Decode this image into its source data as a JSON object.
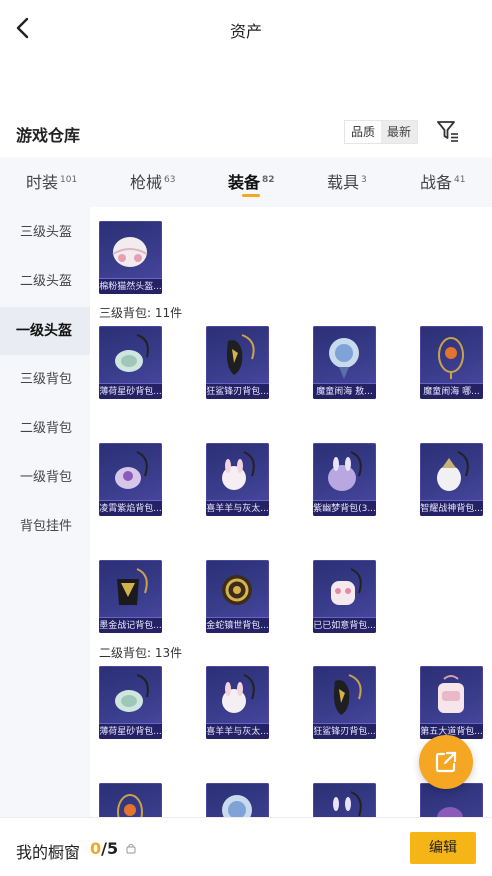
{
  "header": {
    "title": "资产"
  },
  "warehouse": {
    "title": "游戏仓库",
    "sort_options": [
      "品质",
      "最新"
    ],
    "active_sort": "最新"
  },
  "tabs": [
    {
      "label": "时装",
      "count": "101"
    },
    {
      "label": "枪械",
      "count": "63"
    },
    {
      "label": "装备",
      "count": "82",
      "active": true
    },
    {
      "label": "载具",
      "count": "3"
    },
    {
      "label": "战备",
      "count": "41"
    }
  ],
  "sidenav": {
    "items": [
      "三级头盔",
      "二级头盔",
      "一级头盔",
      "三级背包",
      "二级背包",
      "一级背包",
      "背包挂件"
    ],
    "active_index": 2
  },
  "groups": {
    "first": {
      "items": [
        "棉粉猫然头盔..."
      ]
    },
    "level3_bags": {
      "title": "三级背包: 11件",
      "items": [
        "薄荷星砂背包...",
        "狂鲨锋刃背包...",
        "魔童闹海 敖...",
        "魔童闹海 哪...",
        "凌霄紫焰背包...",
        "喜羊羊与灰太...",
        "紫幽梦背包(3...",
        "智耀战神背包...",
        "墨金战记背包...",
        "金蛇镇世背包...",
        "已已如意背包..."
      ]
    },
    "level2_bags": {
      "title": "二级背包: 13件",
      "items": [
        "薄荷星砂背包...",
        "喜羊羊与灰太...",
        "狂鲨锋刃背包...",
        "第五大道背包..."
      ]
    }
  },
  "bottombar": {
    "title": "我的橱窗",
    "count_current": "0",
    "count_total": "/5",
    "edit_label": "编辑"
  },
  "colors": {
    "accent": "#f5a623",
    "card_bg": "#33367e"
  }
}
